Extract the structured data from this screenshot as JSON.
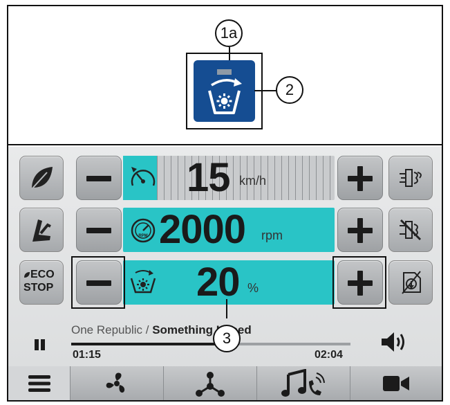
{
  "callouts": {
    "c1a": "1a",
    "c2": "2",
    "c3": "3"
  },
  "controls": {
    "speed": {
      "value": "15",
      "unit": "km/h",
      "fill_percent": 16
    },
    "engine": {
      "value": "2000",
      "unit": "rpm"
    },
    "fan": {
      "value": "20",
      "unit": "%"
    }
  },
  "left_buttons": {
    "eco_stop_line1": "ECO",
    "eco_stop_line2": "STOP"
  },
  "media": {
    "artist": "One Republic /",
    "song": "Something I Need",
    "elapsed": "01:15",
    "total": "02:04",
    "progress": 0.6
  },
  "icons": {
    "left": [
      "leaf-icon",
      "seat-icon",
      "eco-stop-icon"
    ],
    "right": [
      "hydraulic-flow-icon",
      "hydraulic-off-icon",
      "auxiliary-icon"
    ],
    "nav": [
      "menu-icon",
      "fan-icon",
      "network-icon",
      "music-phone-icon",
      "camera-icon"
    ]
  },
  "colors": {
    "teal": "#29c4c6",
    "tile_blue": "#154d92",
    "button_gray": "#b3b6b9"
  }
}
